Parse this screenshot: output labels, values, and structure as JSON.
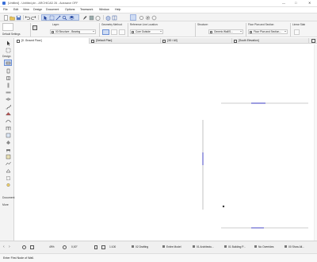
{
  "window": {
    "title": "[Untitled] - Untitled.pln - ARCHICAD 26 - Autosave OFF",
    "controls": {
      "minimize": "—",
      "maximize": "□",
      "close": "✕"
    }
  },
  "menu": [
    "File",
    "Edit",
    "View",
    "Design",
    "Document",
    "Options",
    "Teamwork",
    "Window",
    "Help"
  ],
  "info_box": {
    "label_settings": "Default Settings",
    "label_layer": "Layer:",
    "layer_value": "00 Structure - Bearing",
    "label_geometry": "Geometry Method:",
    "label_reference_line": "Reference Line Location:",
    "reference_line_value": "Core Outside",
    "label_structure": "Structure:",
    "structure_value": "Generic Wall/S...",
    "label_floor_plan": "Floor Plan and Section:",
    "floor_plan_value": "Floor Plan and Section...",
    "label_linear": "Linear Slab"
  },
  "tabs": [
    {
      "label": "[0. Ground Floor]"
    },
    {
      "label": "[Default Plan]"
    },
    {
      "label": "[3D / All]"
    },
    {
      "label": "[South Elevation]"
    }
  ],
  "toolbox": {
    "section_design": "Design",
    "section_document": "Document",
    "section_more": "More"
  },
  "bottom_bar": {
    "zoom": "49%",
    "angle": "0,00°",
    "scale": "1:100",
    "items": [
      "02 Drafting",
      "Entire Model",
      "01 Architectu...",
      "01 Building P...",
      "No Overrides",
      "00 Show All..."
    ]
  },
  "status": {
    "hint": "Enter First Node of Wall."
  },
  "colors": {
    "accent": "#3a6fd8",
    "selection": "#7b7bd6",
    "toolbar_bg": "#f0f0f0"
  }
}
